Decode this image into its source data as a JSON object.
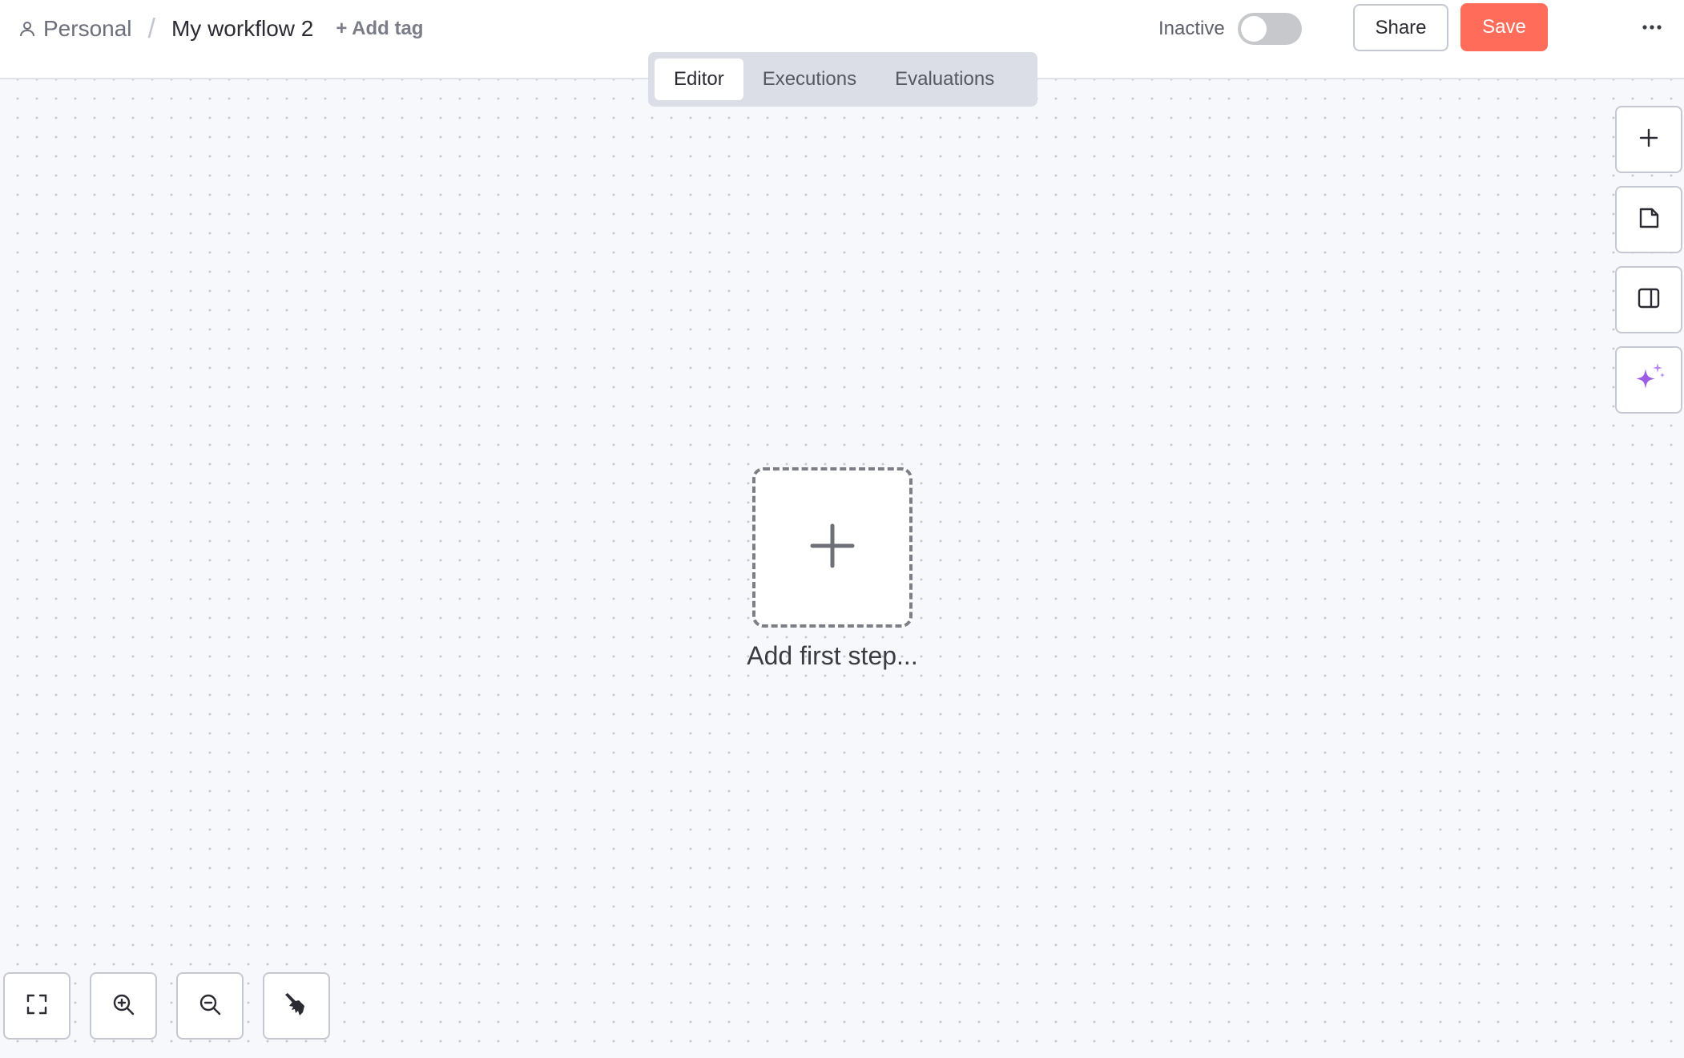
{
  "header": {
    "project": "Personal",
    "separator": "/",
    "workflow_name": "My workflow 2",
    "add_tag": "+ Add tag",
    "status_label": "Inactive",
    "active": false,
    "share_label": "Share",
    "save_label": "Save",
    "more_label": "⋯"
  },
  "tabs": [
    {
      "label": "Editor",
      "active": true
    },
    {
      "label": "Executions",
      "active": false
    },
    {
      "label": "Evaluations",
      "active": false
    }
  ],
  "canvas": {
    "add_first_step_label": "Add first step..."
  },
  "side_toolbar": [
    {
      "icon": "plus-icon"
    },
    {
      "icon": "sticky-note-icon"
    },
    {
      "icon": "panel-right-icon"
    },
    {
      "icon": "sparkles-icon"
    }
  ],
  "zoom_toolbar": [
    {
      "icon": "fit-view-icon"
    },
    {
      "icon": "zoom-in-icon"
    },
    {
      "icon": "zoom-out-icon"
    },
    {
      "icon": "tidy-up-icon"
    }
  ],
  "colors": {
    "save": "#ff6d5a",
    "ai_accent": "#9b5de5",
    "toggle_off": "#c7c8cc",
    "tabs_bg": "#dbdee7"
  }
}
